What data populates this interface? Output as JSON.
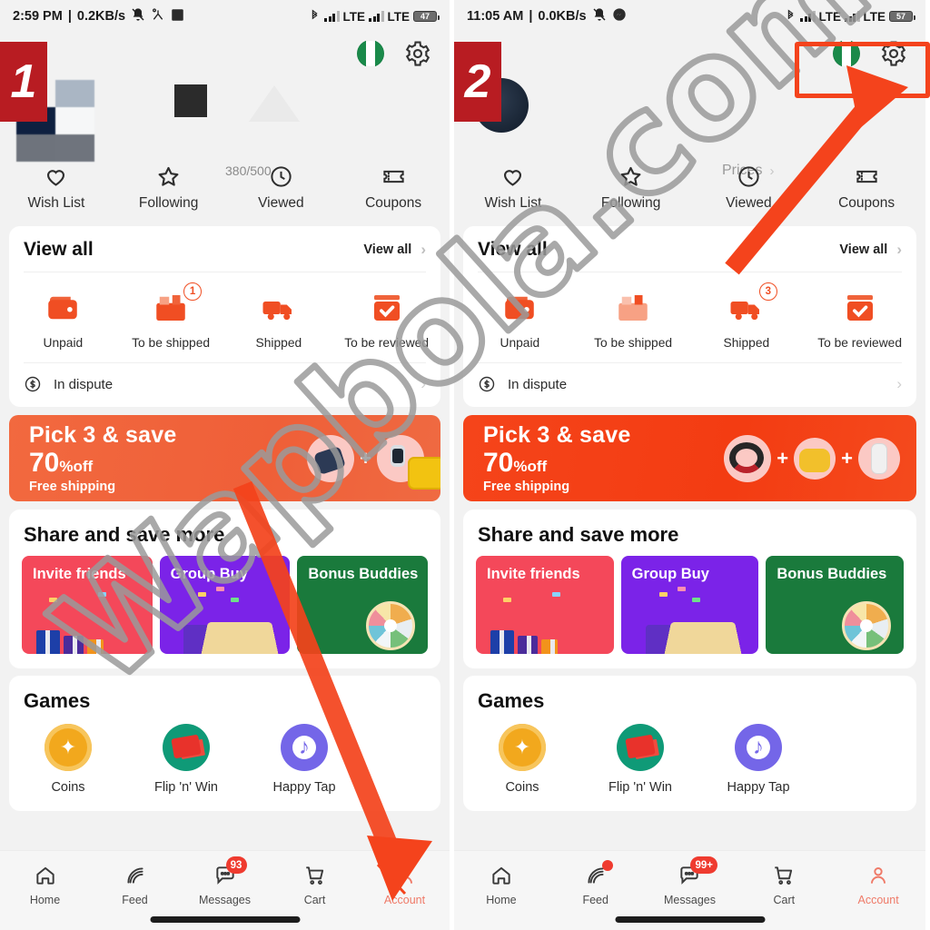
{
  "watermark": {
    "text": "Wapbola.com"
  },
  "panels": [
    {
      "id": "left",
      "step": "1",
      "status": {
        "time": "2:59 PM",
        "speed": "0.2KB/s",
        "mute_icon": "mute-bell-icon",
        "extra_icon": "people-icon",
        "square_icon": "square-icon",
        "bluetooth_icon": "bluetooth-icon",
        "network1": "LTE",
        "network2": "LTE",
        "battery": "47"
      },
      "header": {
        "flag_icon": "nigeria-flag-icon",
        "gear_icon": "gear-icon",
        "counter": "380/500",
        "prices_label": "",
        "quick_actions": [
          {
            "label": "Wish List",
            "icon": "heart-icon"
          },
          {
            "label": "Following",
            "icon": "star-icon"
          },
          {
            "label": "Viewed",
            "icon": "clock-icon"
          },
          {
            "label": "Coupons",
            "icon": "ticket-icon"
          }
        ]
      },
      "orders": {
        "title": "View all",
        "link_label": "View all",
        "chevron": "›",
        "items": [
          {
            "label": "Unpaid",
            "icon": "wallet-icon",
            "badge": ""
          },
          {
            "label": "To be shipped",
            "icon": "package-icon",
            "badge": "1"
          },
          {
            "label": "Shipped",
            "icon": "truck-icon",
            "badge": ""
          },
          {
            "label": "To be reviewed",
            "icon": "review-check-icon",
            "badge": ""
          }
        ],
        "dispute_label": "In dispute",
        "dispute_icon": "refund-dollar-icon"
      },
      "promo": {
        "line1": "Pick 3 & save",
        "line2_big": "70",
        "line2_pct": "%",
        "line2_off": "off",
        "line3": "Free shipping"
      },
      "share": {
        "title": "Share and save more",
        "tiles": [
          {
            "label": "Invite friends",
            "color": "#f4485a"
          },
          {
            "label": "Group Buy",
            "color": "#7b23e8"
          },
          {
            "label": "Bonus Buddies",
            "color": "#1a7a3c"
          }
        ]
      },
      "games": {
        "title": "Games",
        "items": [
          {
            "label": "Coins",
            "icon": "coin-icon"
          },
          {
            "label": "Flip 'n' Win",
            "icon": "cards-icon"
          },
          {
            "label": "Happy Tap",
            "icon": "music-note-icon"
          }
        ]
      },
      "bottomnav": [
        {
          "label": "Home",
          "icon": "home-icon",
          "badge": "",
          "dot": false,
          "active": false
        },
        {
          "label": "Feed",
          "icon": "feed-icon",
          "badge": "",
          "dot": false,
          "active": false
        },
        {
          "label": "Messages",
          "icon": "chat-icon",
          "badge": "93",
          "dot": false,
          "active": false
        },
        {
          "label": "Cart",
          "icon": "cart-icon",
          "badge": "",
          "dot": false,
          "active": false
        },
        {
          "label": "Account",
          "icon": "person-icon",
          "badge": "",
          "dot": false,
          "active": true
        }
      ]
    },
    {
      "id": "right",
      "step": "2",
      "status": {
        "time": "11:05 AM",
        "speed": "0.0KB/s",
        "mute_icon": "mute-bell-icon",
        "extra_icon": "messenger-icon",
        "square_icon": "",
        "bluetooth_icon": "bluetooth-icon",
        "network1": "LTE",
        "network2": "LTE",
        "battery": "57"
      },
      "header": {
        "flag_icon": "nigeria-flag-icon",
        "gear_icon": "gear-icon",
        "counter": "",
        "prices_label": "Prices",
        "quick_actions": [
          {
            "label": "Wish List",
            "icon": "heart-icon"
          },
          {
            "label": "Following",
            "icon": "star-icon"
          },
          {
            "label": "Viewed",
            "icon": "clock-icon"
          },
          {
            "label": "Coupons",
            "icon": "ticket-icon"
          }
        ]
      },
      "orders": {
        "title": "View all",
        "link_label": "View all",
        "chevron": "›",
        "items": [
          {
            "label": "Unpaid",
            "icon": "wallet-icon",
            "badge": ""
          },
          {
            "label": "To be shipped",
            "icon": "package-icon",
            "badge": ""
          },
          {
            "label": "Shipped",
            "icon": "truck-icon",
            "badge": "3"
          },
          {
            "label": "To be reviewed",
            "icon": "review-check-icon",
            "badge": ""
          }
        ],
        "dispute_label": "In dispute",
        "dispute_icon": "refund-dollar-icon"
      },
      "promo": {
        "line1": "Pick 3 & save",
        "line2_big": "70",
        "line2_pct": "%",
        "line2_off": "off",
        "line3": "Free shipping"
      },
      "share": {
        "title": "Share and save more",
        "tiles": [
          {
            "label": "Invite friends",
            "color": "#f4485a"
          },
          {
            "label": "Group Buy",
            "color": "#7b23e8"
          },
          {
            "label": "Bonus Buddies",
            "color": "#1a7a3c"
          }
        ]
      },
      "games": {
        "title": "Games",
        "items": [
          {
            "label": "Coins",
            "icon": "coin-icon"
          },
          {
            "label": "Flip 'n' Win",
            "icon": "cards-icon"
          },
          {
            "label": "Happy Tap",
            "icon": "music-note-icon"
          }
        ]
      },
      "bottomnav": [
        {
          "label": "Home",
          "icon": "home-icon",
          "badge": "",
          "dot": false,
          "active": false
        },
        {
          "label": "Feed",
          "icon": "feed-icon",
          "badge": "",
          "dot": true,
          "active": false
        },
        {
          "label": "Messages",
          "icon": "chat-icon",
          "badge": "99+",
          "dot": false,
          "active": false
        },
        {
          "label": "Cart",
          "icon": "cart-icon",
          "badge": "",
          "dot": false,
          "active": false
        },
        {
          "label": "Account",
          "icon": "person-icon",
          "badge": "",
          "dot": false,
          "active": true
        }
      ]
    }
  ],
  "annotations": {
    "highlight_color": "#f4431c",
    "arrow_color": "#f4431c",
    "badge_bg": "#b81c22",
    "badge_fg": "#ffffff"
  }
}
